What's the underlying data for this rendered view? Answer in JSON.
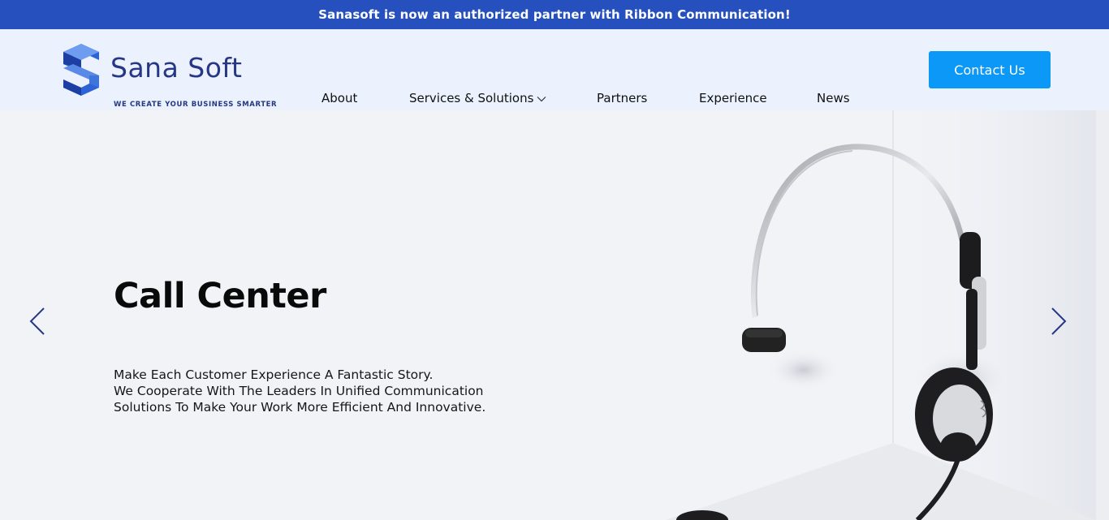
{
  "announcement": "Sanasoft is now an authorized partner with Ribbon Communication!",
  "logo": {
    "name": "Sana Soft",
    "tagline": "WE CREATE YOUR BUSINESS SMARTER"
  },
  "nav": {
    "about": "About",
    "services": "Services & Solutions",
    "partners": "Partners",
    "experience": "Experience",
    "news": "News"
  },
  "contact_label": "Contact Us",
  "hero": {
    "title": "Call Center",
    "desc": [
      "Make Each Customer Experience A Fantastic Story.",
      "We Cooperate With The Leaders In Unified Communication",
      "Solutions To Make Your Work More Efficient And Innovative."
    ]
  },
  "icons": {
    "prev": "chevron-left-icon",
    "next": "chevron-right-icon",
    "dropdown": "chevron-down-icon"
  },
  "colors": {
    "announcement_bg": "#2550be",
    "header_bg": "#ebf2fd",
    "brand": "#253785",
    "button": "#0b98f6",
    "arrows": "#253785"
  }
}
